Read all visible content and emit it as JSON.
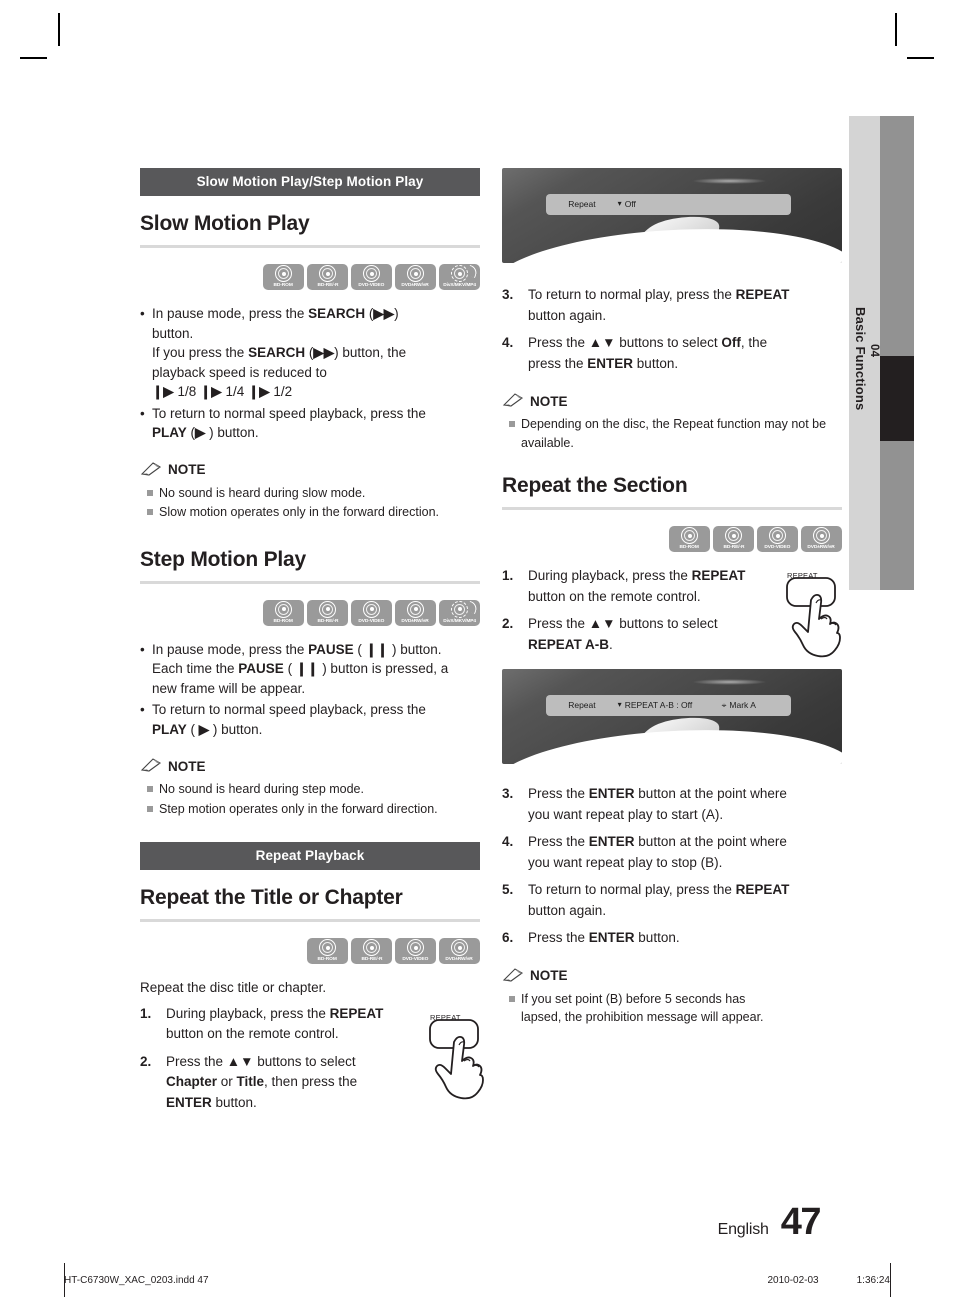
{
  "side_tab": {
    "chapter_number": "04",
    "chapter_title": "Basic Functions"
  },
  "footer": {
    "language": "English",
    "page_number": "47",
    "print_file": "HT-C6730W_XAC_0203.indd   47",
    "print_date": "2010-02-03",
    "print_time": "1:36:24"
  },
  "banners": {
    "slow_step": "Slow Motion Play/Step Motion Play",
    "repeat_playback": "Repeat Playback"
  },
  "disc_labels": {
    "bd_rom": "BD-ROM",
    "bd_re_r": "BD-RE/-R",
    "dvd_video": "DVD-VIDEO",
    "dvd_rw_r": "DVD±RW/±R",
    "divx": "DivX/MKV/MP4"
  },
  "note_label": "NOTE",
  "sections": {
    "slow_motion": {
      "heading": "Slow Motion Play",
      "bullets": [
        "In pause mode, press the SEARCH (▶▶) button.\nIf you press the SEARCH (▶▶) button, the playback speed is reduced to\n❙▶ 1/8 ❙▶ 1/4 ❙▶ 1/2",
        "To return to normal speed playback, press the PLAY (▶ ) button."
      ],
      "notes": [
        "No sound is heard during slow mode.",
        "Slow motion operates only in the forward direction."
      ]
    },
    "step_motion": {
      "heading": "Step Motion Play",
      "bullets": [
        "In pause mode, press the PAUSE ( ❙❙ ) button. Each time the PAUSE ( ❙❙ ) button is pressed, a new frame will be appear.",
        "To return to normal speed playback, press the PLAY ( ▶ ) button."
      ],
      "notes": [
        "No sound is heard during step mode.",
        "Step motion operates only in the forward direction."
      ]
    },
    "repeat_title_chapter": {
      "heading": "Repeat the Title or Chapter",
      "intro": "Repeat the disc title or chapter.",
      "steps": [
        {
          "n": "1.",
          "text": "During playback, press the REPEAT button on the remote control."
        },
        {
          "n": "2.",
          "text": "Press the ▲▼ buttons to select Chapter or Title, then press the ENTER button."
        },
        {
          "n": "3.",
          "text": "To return to normal play, press the REPEAT button again."
        },
        {
          "n": "4.",
          "text": "Press the ▲▼ buttons to select Off, the press the ENTER button."
        }
      ],
      "notes": [
        "Depending on the disc, the Repeat function may not be available."
      ]
    },
    "repeat_section": {
      "heading": "Repeat the Section",
      "steps": [
        {
          "n": "1.",
          "text": "During playback, press the REPEAT button on the remote control."
        },
        {
          "n": "2.",
          "text": "Press the ▲▼ buttons to select REPEAT A-B."
        },
        {
          "n": "3.",
          "text": "Press the ENTER button at the point where you want repeat play to start (A)."
        },
        {
          "n": "4.",
          "text": "Press the ENTER button at the point where you want repeat play to stop (B)."
        },
        {
          "n": "5.",
          "text": "To return to normal play, press the REPEAT button again."
        },
        {
          "n": "6.",
          "text": "Press the ENTER button."
        }
      ],
      "notes": [
        "If you set point (B) before 5 seconds has lapsed, the prohibition message will appear."
      ]
    }
  },
  "screenshots": {
    "repeat_off": {
      "field": "Repeat",
      "value": "Off"
    },
    "repeat_ab": {
      "field": "Repeat",
      "value": "REPEAT A-B : Off",
      "mark": "Mark A"
    }
  },
  "remote": {
    "button_caption": "REPEAT"
  }
}
